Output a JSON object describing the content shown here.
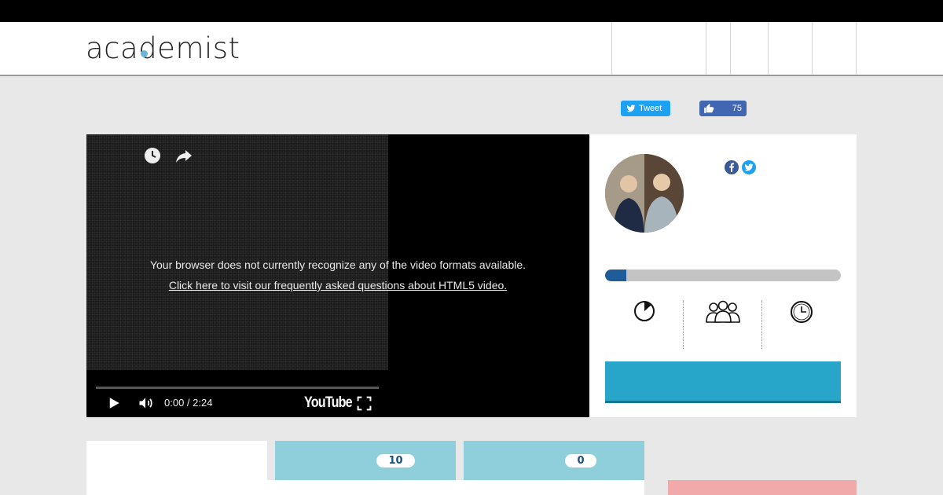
{
  "header": {
    "logo_text": "academist",
    "accent_color": "#6ab6d6"
  },
  "social": {
    "tweet_label": "Tweet",
    "like_count": "75"
  },
  "video": {
    "error_message": "Your browser does not currently recognize any of the video formats available.",
    "faq_link": "Click here to visit our frequently asked questions about HTML5 video.",
    "timecode": "0:00 / 2:24",
    "brand": "YouTube",
    "icons": [
      "watch-later-icon",
      "share-icon",
      "play-icon",
      "volume-icon",
      "fullscreen-icon"
    ]
  },
  "project": {
    "funding_progress": 0.09,
    "stats_icons": [
      "pie-chart-icon",
      "supporters-icon",
      "clock-icon"
    ],
    "cta_color": "#27a6c9"
  },
  "tabs": [
    {
      "badge": ""
    },
    {
      "badge": "10"
    },
    {
      "badge": "0"
    }
  ]
}
